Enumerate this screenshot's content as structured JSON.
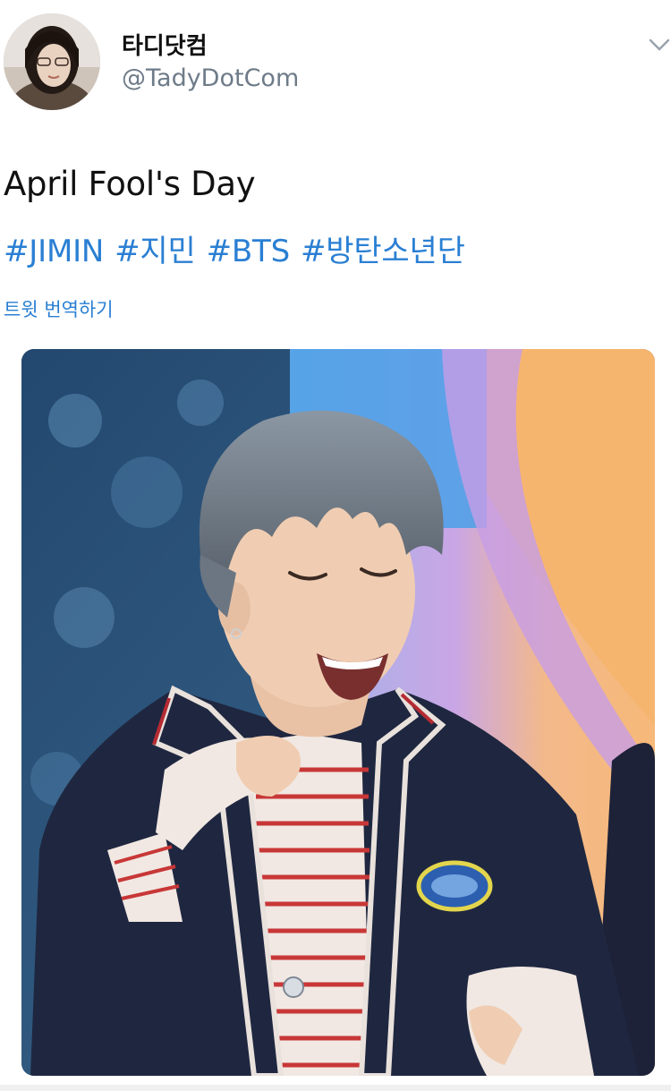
{
  "tweet": {
    "author": {
      "display_name": "타디닷컴",
      "handle": "@TadyDotCom",
      "avatar_icon": "profile-photo"
    },
    "text": "April Fool's Day",
    "hashtags": [
      "#JIMIN",
      "#지민",
      "#BTS",
      "#방탄소년단"
    ],
    "translate_label": "트윗 번역하기",
    "menu_icon": "chevron-down-icon",
    "media_description_icon": "attached-photo",
    "colors": {
      "link": "#2a7fd3",
      "handle": "#6e7b88",
      "text": "#111111"
    }
  }
}
